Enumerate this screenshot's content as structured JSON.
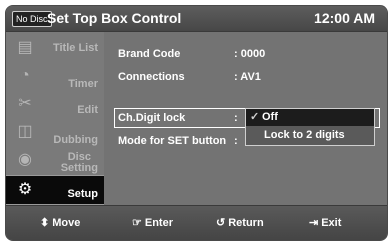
{
  "header": {
    "badge": "No Disc",
    "title": "Set Top Box Control",
    "clock": "12:00 AM"
  },
  "sidebar": {
    "items": [
      {
        "label": "Title List",
        "icon": "film-strip-icon"
      },
      {
        "label": "Timer",
        "icon": "clock-icon"
      },
      {
        "label": "Edit",
        "icon": "scissors-icon"
      },
      {
        "label": "Dubbing",
        "icon": "dubbing-icon"
      },
      {
        "label_line1": "Disc",
        "label_line2": "Setting",
        "icon": "disc-icon"
      },
      {
        "label": "Setup",
        "icon": "gear-icon",
        "active": true
      }
    ]
  },
  "settings": [
    {
      "label": "Brand Code",
      "value": ": 0000"
    },
    {
      "label": "Connections",
      "value": ": AV1"
    },
    {
      "label": "Ch.Digit lock",
      "value": ":"
    },
    {
      "label": "Mode for SET button",
      "value": ":"
    }
  ],
  "dropdown": {
    "options": [
      "Off",
      "Lock to 2 digits"
    ],
    "selected": "Off",
    "check": "✓"
  },
  "footer": {
    "move": "Move",
    "enter": "Enter",
    "return": "Return",
    "exit": "Exit",
    "move_glyph": "⬍",
    "enter_glyph": "☞",
    "return_glyph": "↺",
    "exit_glyph": "⇥"
  }
}
